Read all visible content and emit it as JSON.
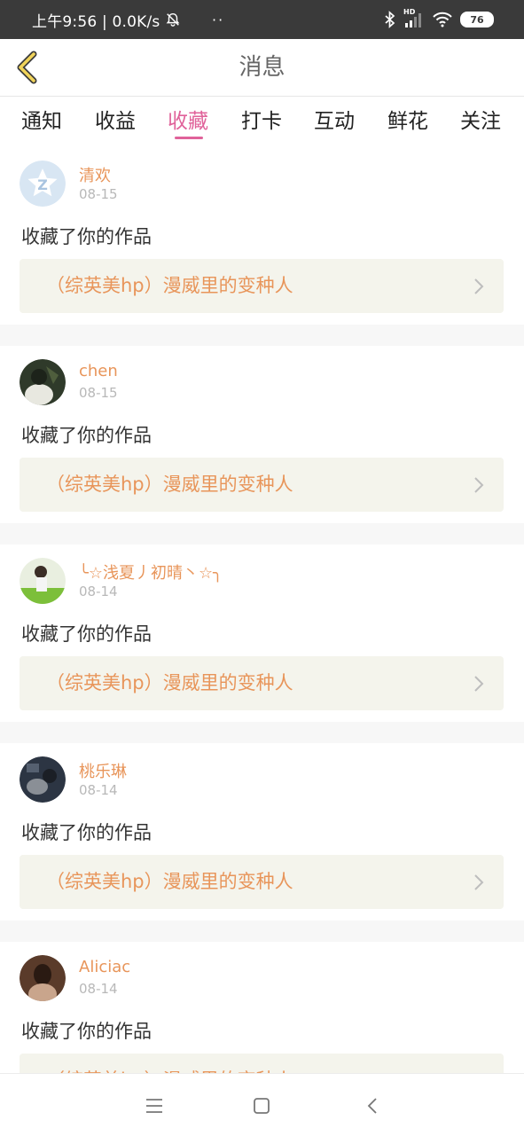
{
  "status_bar": {
    "time_speed": "上午9:56 | 0.0K/s",
    "dots": "··",
    "hd_label": "HD",
    "battery": "76"
  },
  "header": {
    "title": "消息"
  },
  "tabs": [
    {
      "label": "通知",
      "active": false
    },
    {
      "label": "收益",
      "active": false
    },
    {
      "label": "收藏",
      "active": true
    },
    {
      "label": "打卡",
      "active": false
    },
    {
      "label": "互动",
      "active": false
    },
    {
      "label": "鲜花",
      "active": false
    },
    {
      "label": "关注",
      "active": false
    }
  ],
  "items": [
    {
      "user": "清欢",
      "date": "08-15",
      "action": "收藏了你的作品",
      "work": "（综英美hp）漫威里的变种人"
    },
    {
      "user": "chen",
      "date": "08-15",
      "action": "收藏了你的作品",
      "work": "（综英美hp）漫威里的变种人"
    },
    {
      "user": "╰☆浅夏丿初晴丶☆╮",
      "date": "08-14",
      "action": "收藏了你的作品",
      "work": "（综英美hp）漫威里的变种人"
    },
    {
      "user": "桃乐琳",
      "date": "08-14",
      "action": "收藏了你的作品",
      "work": "（综英美hp）漫威里的变种人"
    },
    {
      "user": "Aliciac",
      "date": "08-14",
      "action": "收藏了你的作品",
      "work": "（综英美hp）漫威里的变种人"
    }
  ],
  "colors": {
    "accent": "#e0629a",
    "username": "#e8955a",
    "work_box_bg": "#f4f4ec",
    "status_bar_bg": "#3a3a3a"
  }
}
